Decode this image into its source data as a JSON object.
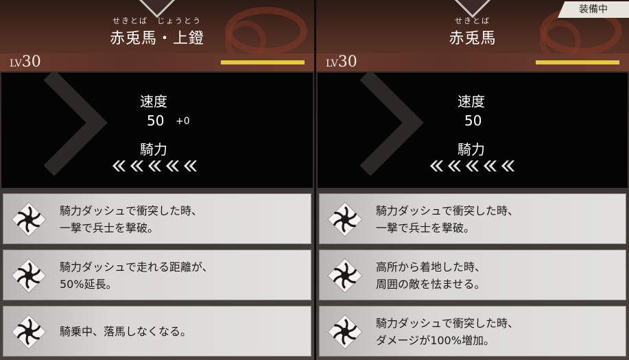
{
  "left": {
    "ruby": "せきとば　じょうとう",
    "title": "赤兎馬・上鐙",
    "level_label": "LV",
    "level": "30",
    "xp_progress": 1.0,
    "stats": {
      "speed_label": "速度",
      "speed_value": "50",
      "speed_bonus": "+0",
      "riding_label": "騎力",
      "riding_level": 5
    },
    "skills": [
      {
        "text": "騎力ダッシュで衝突した時、\n一撃で兵士を撃破。"
      },
      {
        "text": "騎力ダッシュで走れる距離が、\n50%延長。"
      },
      {
        "text": "騎乗中、落馬しなくなる。"
      }
    ]
  },
  "right": {
    "ruby": "せきとば",
    "title": "赤兎馬",
    "equipped_badge": "装備中",
    "level_label": "LV",
    "level": "30",
    "xp_progress": 1.0,
    "stats": {
      "speed_label": "速度",
      "speed_value": "50",
      "riding_label": "騎力",
      "riding_level": 5
    },
    "skills": [
      {
        "text": "騎力ダッシュで衝突した時、\n一撃で兵士を撃破。"
      },
      {
        "text": "高所から着地した時、\n周囲の敵を怯ませる。"
      },
      {
        "text": "騎力ダッシュで衝突した時、\nダメージが100%増加。"
      }
    ]
  },
  "colors": {
    "xp_bar": "#e3c94a",
    "header_red": "#5a3226",
    "skill_card": "#dcdad8"
  },
  "icons": {
    "skill": "swirl-icon",
    "riding": "double-chevron-left-icon"
  }
}
